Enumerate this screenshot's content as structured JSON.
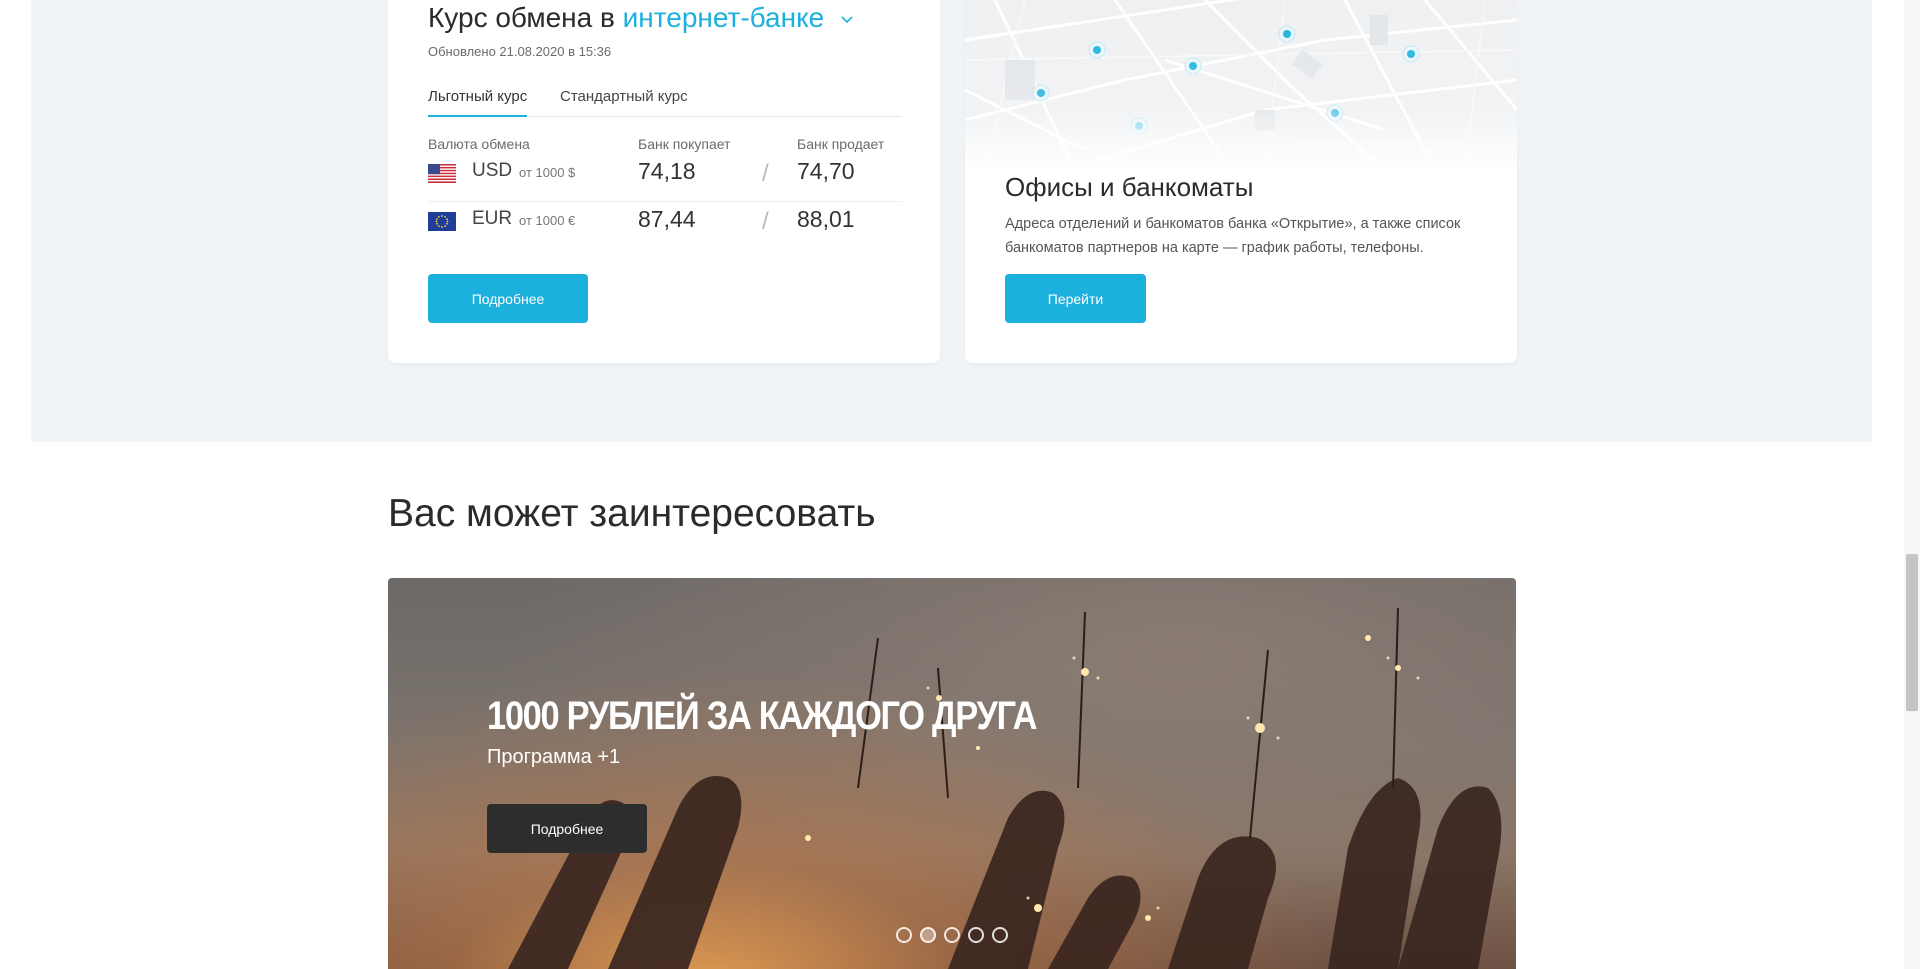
{
  "rates": {
    "title_prefix": "Курс обмена в",
    "title_link": "интернет-банке",
    "updated": "Обновлено 21.08.2020 в 15:36",
    "tabs": [
      {
        "label": "Льготный курс",
        "active": true
      },
      {
        "label": "Стандартный курс",
        "active": false
      }
    ],
    "columns": [
      "Валюта обмена",
      "Банк покупает",
      "Банк продает"
    ],
    "rows": [
      {
        "currency": "USD",
        "min": "от 1000 $",
        "buy": "74,18",
        "sell": "74,70",
        "flag": "us-flag-icon"
      },
      {
        "currency": "EUR",
        "min": "от 1000 €",
        "buy": "87,44",
        "sell": "88,01",
        "flag": "eu-flag-icon"
      }
    ],
    "separator": "/",
    "button": "Подробнее"
  },
  "offices": {
    "title": "Офисы и банкоматы",
    "description": "Адреса отделений и банкоматов банка «Открытие», а также список банкоматов партнеров на карте — график работы, телефоны.",
    "button": "Перейти"
  },
  "interest": {
    "title": "Вас может заинтересовать"
  },
  "banner": {
    "title": "1000 РУБЛЕЙ ЗА КАЖДОГО ДРУГА",
    "subtitle": "Программа +1",
    "button": "Подробнее",
    "slides": 5,
    "active_slide": 2
  },
  "colors": {
    "accent": "#1cb0dd",
    "section_bg": "#f1f4f7",
    "dark_button": "#2d2d2d"
  }
}
